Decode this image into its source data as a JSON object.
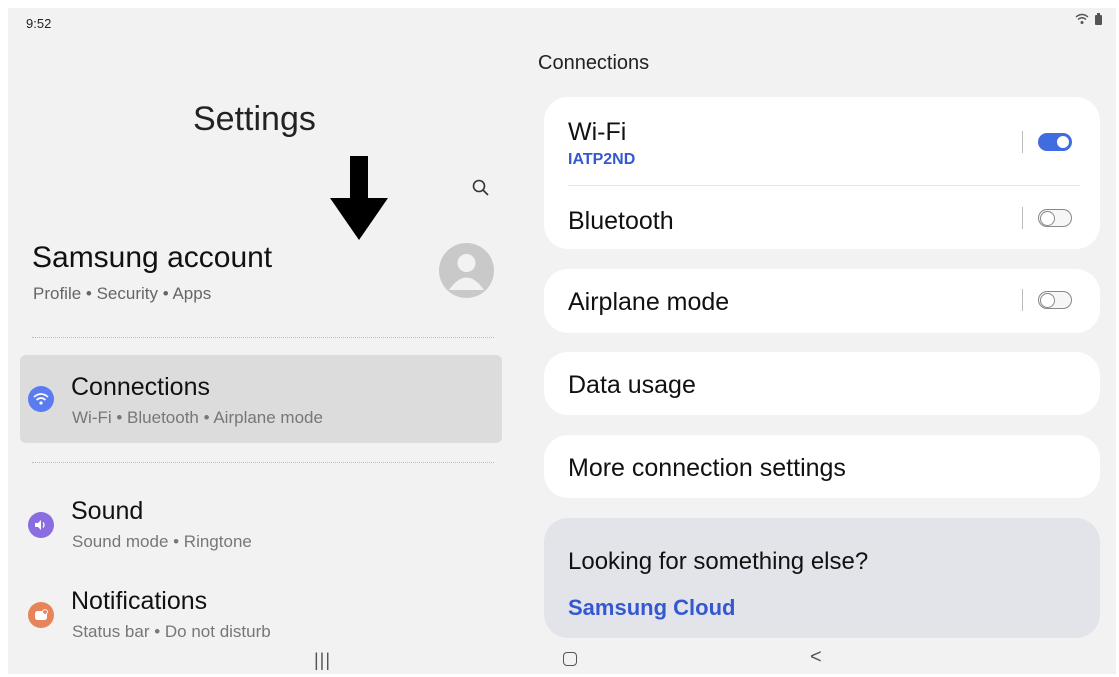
{
  "status": {
    "time": "9:52",
    "icons": "wifi-icon battery-icon"
  },
  "left": {
    "title": "Settings",
    "account": {
      "name": "Samsung account",
      "subtitle": "Profile • Security • Apps"
    },
    "menu": [
      {
        "title": "Connections",
        "subtitle": "Wi-Fi • Bluetooth • Airplane mode",
        "icon": "wifi-icon",
        "color": "#5b7bf0",
        "selected": true
      },
      {
        "title": "Sound",
        "subtitle": "Sound mode • Ringtone",
        "icon": "speaker-icon",
        "color": "#8a6de0"
      },
      {
        "title": "Notifications",
        "subtitle": "Status bar • Do not disturb",
        "icon": "notification-icon",
        "color": "#e8845a"
      }
    ]
  },
  "right": {
    "title": "Connections",
    "wifi": {
      "label": "Wi-Fi",
      "network": "IATP2ND",
      "enabled": true
    },
    "bluetooth": {
      "label": "Bluetooth",
      "enabled": false
    },
    "airplane": {
      "label": "Airplane mode",
      "enabled": false
    },
    "data_usage": {
      "label": "Data usage"
    },
    "more": {
      "label": "More connection settings"
    },
    "suggestion": {
      "title": "Looking for something else?",
      "link": "Samsung Cloud"
    }
  },
  "nav": {
    "recent": "|||",
    "home": "home-icon",
    "back": "<"
  },
  "colors": {
    "accent": "#3f6ce0",
    "link": "#3558d0",
    "selected_row": "#dcdcdc",
    "background": "#f2f2f2"
  }
}
